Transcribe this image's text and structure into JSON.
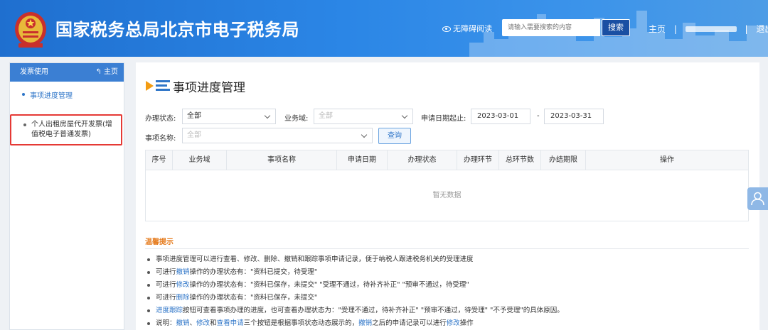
{
  "header": {
    "title": "国家税务总局北京市电子税务局",
    "a11y_label": "无障碍阅读",
    "search_placeholder": "请输入需要搜索的内容",
    "search_button": "搜索",
    "home_link": "主页",
    "separator": "|",
    "logout_link": "退出"
  },
  "sidebar": {
    "header_label": "发票使用",
    "home_label": "↰ 主页",
    "items": [
      {
        "label": "事项进度管理"
      },
      {
        "label": "个人出租房屋代开发票(增值税电子普通发票)"
      }
    ]
  },
  "main": {
    "page_title": "事项进度管理",
    "filters": {
      "status_label": "办理状态:",
      "status_value": "全部",
      "domain_label": "业务域:",
      "domain_value": "全部",
      "date_label": "申请日期起止:",
      "date_start": "2023-03-01",
      "date_separator": "-",
      "date_end": "2023-03-31",
      "name_label": "事项名称:",
      "name_value": "全部",
      "query_button": "查询"
    },
    "table": {
      "columns": [
        "序号",
        "业务域",
        "事项名称",
        "申请日期",
        "办理状态",
        "办理环节",
        "总环节数",
        "办结期限",
        "操作"
      ],
      "empty_text": "暂无数据"
    },
    "tips": {
      "title": "温馨提示",
      "lines": [
        {
          "t1": "事项进度管理可以进行查看、修改、删除、撤销和跟踪事项申请记录，便于纳税人跟进税务机关的受理进度"
        },
        {
          "t1": "可进行",
          "lk1": "撤销",
          "t2": "操作的办理状态有：\"资料已提交，待受理\""
        },
        {
          "t1": "可进行",
          "lk1": "修改",
          "t2": "操作的办理状态有：\"资料已保存，未提交\"  \"受理不通过，待补齐补正\"  \"预审不通过，待受理\""
        },
        {
          "t1": "可进行",
          "lk1": "删除",
          "t2": "操作的办理状态有：\"资料已保存，未提交\""
        },
        {
          "lk1": "进度跟踪",
          "t2": "按钮可查看事项办理的进度，也可查看办理状态为：\"受理不通过，待补齐补正\"  \"预审不通过，待受理\"  \"不予受理\"的具体原因。"
        },
        {
          "t1": "说明：",
          "lk1": "撤销",
          "t2": "、",
          "lk2": "修改",
          "t3": "和",
          "lk3": "查看申请",
          "t4": "三个按钮是根据事项状态动态展示的，",
          "lk4": "撤销",
          "t5": "之后的申请记录可以进行",
          "lk5": "修改",
          "t6": "操作"
        }
      ]
    }
  },
  "colors": {
    "header_blue": "#2b86e6",
    "sidebar_header": "#3b7fd3",
    "link_blue": "#2e75c8",
    "tips_orange": "#e67e22",
    "highlight_red": "#e53935"
  }
}
